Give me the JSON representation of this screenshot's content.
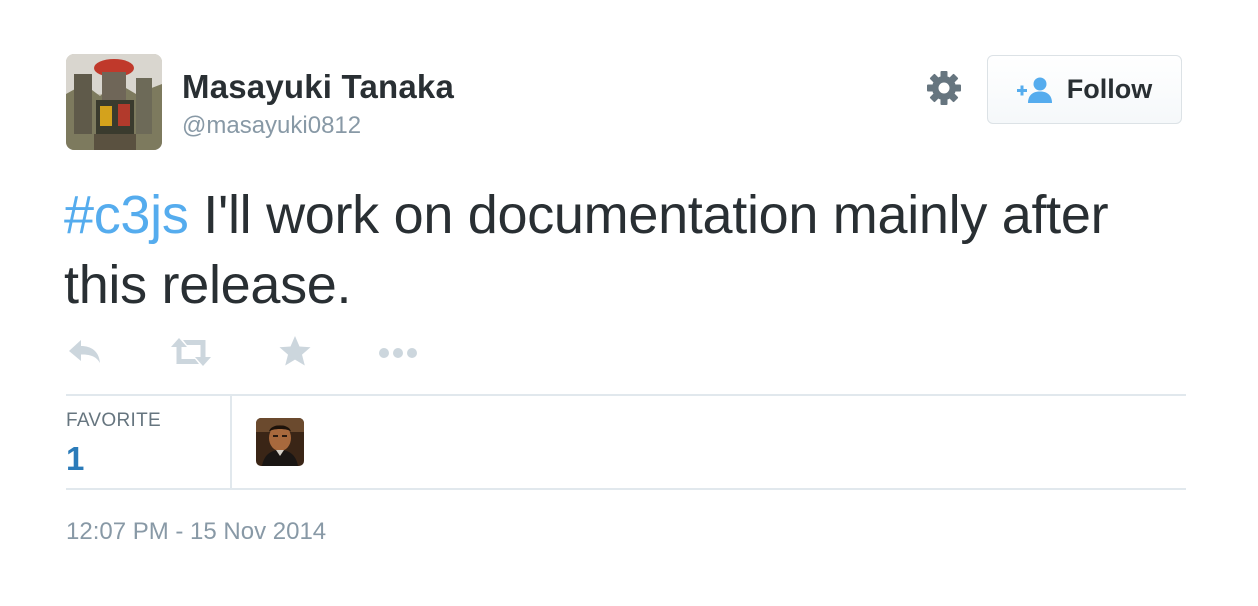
{
  "author": {
    "display_name": "Masayuki Tanaka",
    "screen_name": "@masayuki0812",
    "avatar_icon": "profile-photo"
  },
  "header": {
    "settings_icon": "gear-icon",
    "follow_label": "Follow",
    "follow_icon": "add-user-icon"
  },
  "tweet": {
    "hashtag": "#c3js",
    "text": " I'll work on documentation mainly after this release."
  },
  "actions": {
    "reply_icon": "reply-icon",
    "retweet_icon": "retweet-icon",
    "favorite_icon": "star-icon",
    "more_icon": "ellipsis-icon"
  },
  "stats": {
    "favorite_label": "FAVORITE",
    "favorite_count": "1"
  },
  "timestamp": "12:07 PM - 15 Nov 2014",
  "colors": {
    "text": "#292f33",
    "muted": "#8899a6",
    "link": "#55acee",
    "count": "#2b7bb9",
    "border": "#e1e8ed",
    "action_icon": "#ccd6dd"
  }
}
